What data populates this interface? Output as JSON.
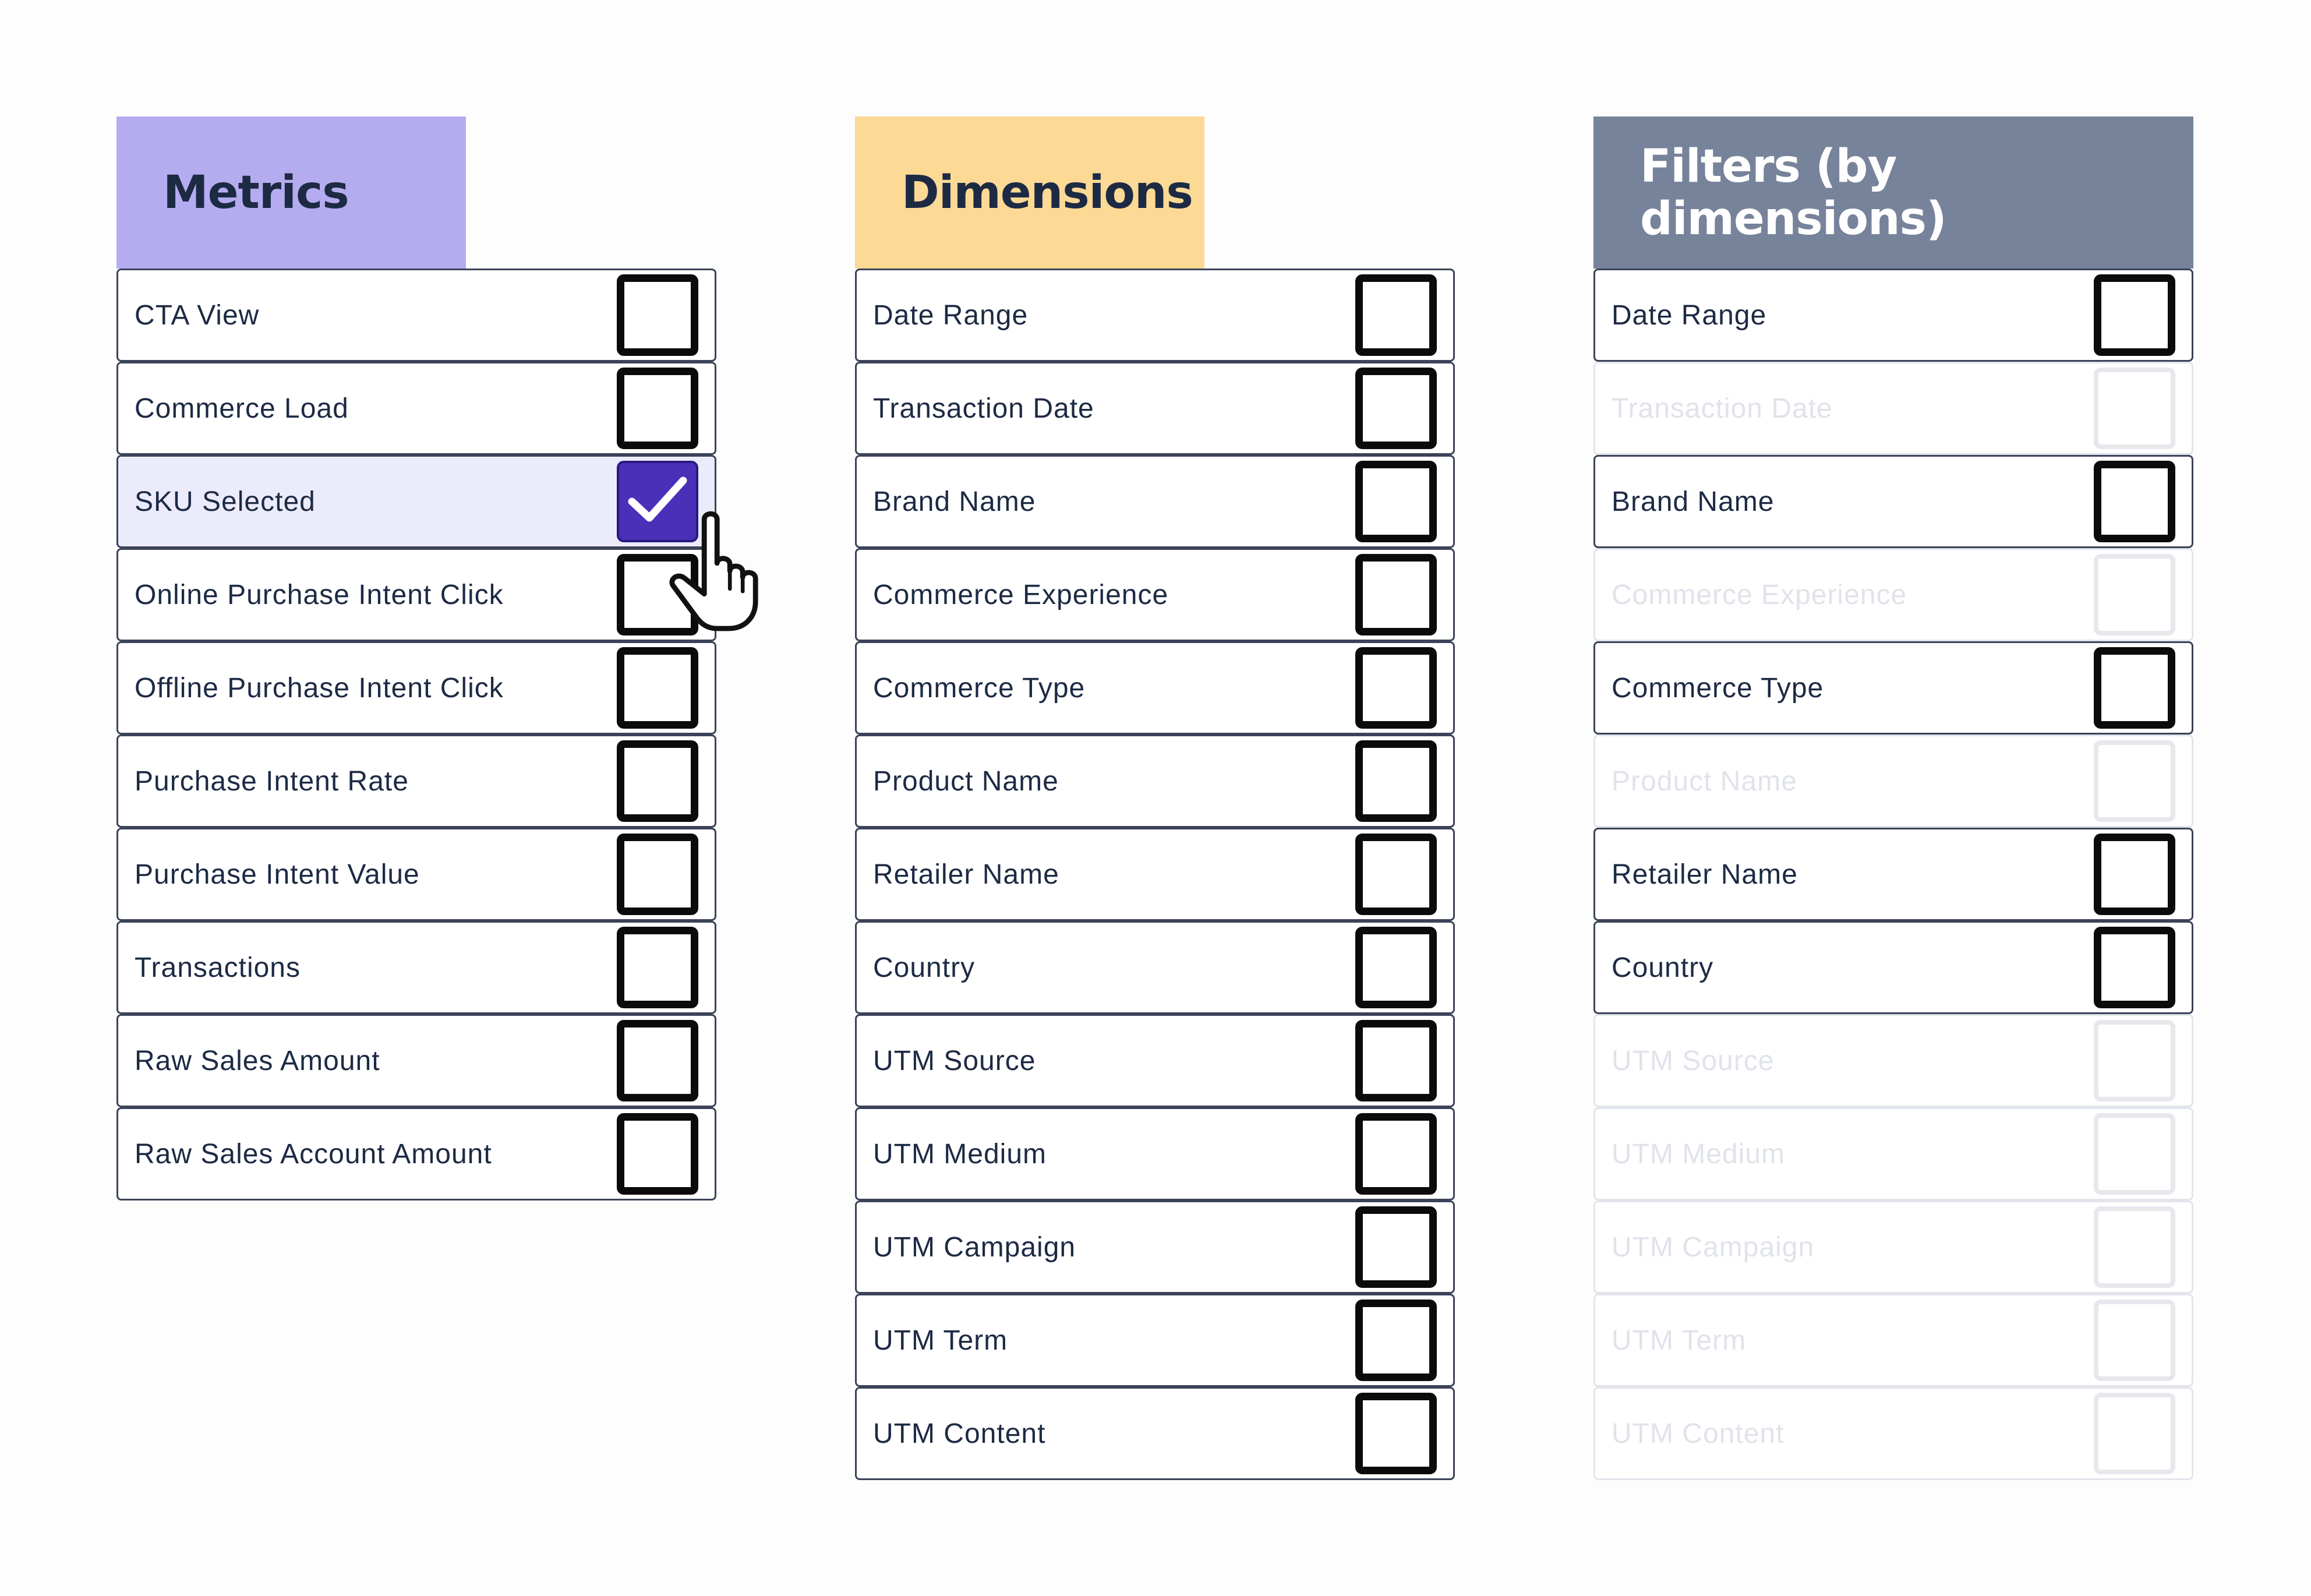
{
  "metrics": {
    "title": "Metrics",
    "items": [
      {
        "label": "CTA View",
        "checked": false
      },
      {
        "label": "Commerce Load",
        "checked": false
      },
      {
        "label": "SKU Selected",
        "checked": true
      },
      {
        "label": "Online Purchase Intent Click",
        "checked": false
      },
      {
        "label": "Offline Purchase Intent Click",
        "checked": false
      },
      {
        "label": "Purchase Intent Rate",
        "checked": false
      },
      {
        "label": "Purchase Intent Value",
        "checked": false
      },
      {
        "label": "Transactions",
        "checked": false
      },
      {
        "label": "Raw Sales Amount",
        "checked": false
      },
      {
        "label": "Raw Sales Account Amount",
        "checked": false
      }
    ]
  },
  "dimensions": {
    "title": "Dimensions",
    "items": [
      {
        "label": "Date Range",
        "checked": false
      },
      {
        "label": "Transaction Date",
        "checked": false
      },
      {
        "label": "Brand Name",
        "checked": false
      },
      {
        "label": "Commerce Experience",
        "checked": false
      },
      {
        "label": "Commerce Type",
        "checked": false
      },
      {
        "label": "Product Name",
        "checked": false
      },
      {
        "label": "Retailer Name",
        "checked": false
      },
      {
        "label": "Country",
        "checked": false
      },
      {
        "label": "UTM Source",
        "checked": false
      },
      {
        "label": "UTM Medium",
        "checked": false
      },
      {
        "label": "UTM Campaign",
        "checked": false
      },
      {
        "label": "UTM Term",
        "checked": false
      },
      {
        "label": "UTM Content",
        "checked": false
      }
    ]
  },
  "filters": {
    "title": "Filters (by dimensions)",
    "items": [
      {
        "label": "Date Range",
        "checked": false,
        "disabled": false
      },
      {
        "label": "Transaction Date",
        "checked": false,
        "disabled": true
      },
      {
        "label": "Brand Name",
        "checked": false,
        "disabled": false
      },
      {
        "label": "Commerce Experience",
        "checked": false,
        "disabled": true
      },
      {
        "label": "Commerce Type",
        "checked": false,
        "disabled": false
      },
      {
        "label": "Product Name",
        "checked": false,
        "disabled": true
      },
      {
        "label": "Retailer Name",
        "checked": false,
        "disabled": false
      },
      {
        "label": "Country",
        "checked": false,
        "disabled": false
      },
      {
        "label": "UTM Source",
        "checked": false,
        "disabled": true
      },
      {
        "label": "UTM Medium",
        "checked": false,
        "disabled": true
      },
      {
        "label": "UTM Campaign",
        "checked": false,
        "disabled": true
      },
      {
        "label": "UTM Term",
        "checked": false,
        "disabled": true
      },
      {
        "label": "UTM Content",
        "checked": false,
        "disabled": true
      }
    ]
  },
  "colors": {
    "metrics_header": "#b5acf0",
    "dimensions_header": "#fcd995",
    "filters_header": "#76839a",
    "checked_fill": "#4a2fb8",
    "selected_row": "#ecebfb"
  },
  "icons": {
    "checkmark": "checkmark-icon",
    "cursor": "hand-pointer-icon"
  }
}
